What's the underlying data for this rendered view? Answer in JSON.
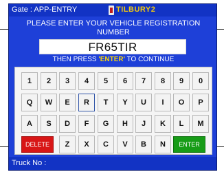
{
  "header": {
    "gate_label": "Gate : APP-ENTRY",
    "logo_text": "TILBURY2"
  },
  "prompt": {
    "line1": "PLEASE ENTER YOUR VEHICLE REGISTRATION",
    "line2": "NUMBER"
  },
  "registration_field": {
    "value": "FR65TIR"
  },
  "instruction": {
    "prefix": "THEN PRESS ",
    "highlight": "'ENTER'",
    "suffix": " TO CONTINUE"
  },
  "keypad": {
    "row1": [
      "1",
      "2",
      "3",
      "4",
      "5",
      "6",
      "7",
      "8",
      "9",
      "0"
    ],
    "row2": [
      "Q",
      "W",
      "E",
      "R",
      "T",
      "Y",
      "U",
      "I",
      "O",
      "P"
    ],
    "row3": [
      "A",
      "S",
      "D",
      "F",
      "G",
      "H",
      "J",
      "K",
      "L",
      "M"
    ],
    "row4_letters": [
      "Z",
      "X",
      "C",
      "V",
      "B",
      "N"
    ],
    "delete_label": "DELETE",
    "enter_label": "ENTER",
    "selected_key": "R"
  },
  "footer": {
    "truck_label": "Truck No :"
  },
  "colors": {
    "screen_blue": "#1e40d8",
    "bar_blue": "#1233c4",
    "highlight_yellow": "#f2d20f",
    "delete_red": "#d81616",
    "enter_green": "#179c17"
  }
}
